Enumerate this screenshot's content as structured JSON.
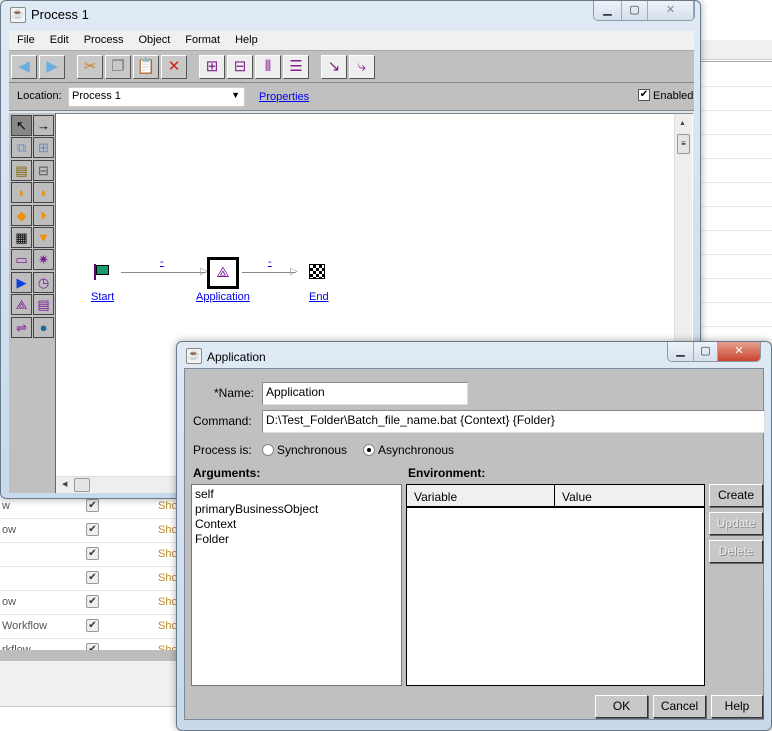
{
  "background": {
    "rows": [
      {
        "text": "w"
      },
      {
        "text": "ow"
      },
      {
        "text": ""
      },
      {
        "text": ""
      },
      {
        "text": "ow"
      },
      {
        "text": "Workflow"
      },
      {
        "text": "rkflow"
      }
    ],
    "column_text": "Sho"
  },
  "process_window": {
    "title": "Process 1",
    "menu": [
      "File",
      "Edit",
      "Process",
      "Object",
      "Format",
      "Help"
    ],
    "toolbar": {
      "icons": [
        "back-icon",
        "forward-icon",
        "cut-icon",
        "copy-icon",
        "paste-icon",
        "delete-icon",
        "align-horizontal-icon",
        "align-vertical-icon",
        "distribute-horizontal-icon",
        "distribute-vertical-icon",
        "straight-link-icon",
        "elbow-link-icon"
      ]
    },
    "location_label": "Location:",
    "location_value": "Process 1",
    "properties_link": "Properties",
    "enabled_label": "Enabled",
    "enabled_checked": true,
    "diagram": {
      "nodes": [
        {
          "label": "Start",
          "icon": "green-flag-icon"
        },
        {
          "label": "Application",
          "icon": "application-icon"
        },
        {
          "label": "End",
          "icon": "checkered-flag-icon"
        }
      ],
      "links": [
        {
          "label": "-"
        },
        {
          "label": "-"
        }
      ]
    }
  },
  "dialog": {
    "title": "Application",
    "name_label": "*Name:",
    "name_value": "Application",
    "command_label": "Command:",
    "command_value": "D:\\Test_Folder\\Batch_file_name.bat {Context} {Folder}",
    "process_is_label": "Process is:",
    "sync_label": "Synchronous",
    "async_label": "Asynchronous",
    "selected_mode": "Asynchronous",
    "arguments_label": "Arguments:",
    "arguments": [
      "self",
      "primaryBusinessObject",
      "Context",
      "Folder"
    ],
    "environment_label": "Environment:",
    "env_columns": [
      "Variable",
      "Value"
    ],
    "create_label": "Create",
    "update_label": "Update",
    "delete_label": "Delete",
    "ok_label": "OK",
    "cancel_label": "Cancel",
    "help_label": "Help"
  }
}
